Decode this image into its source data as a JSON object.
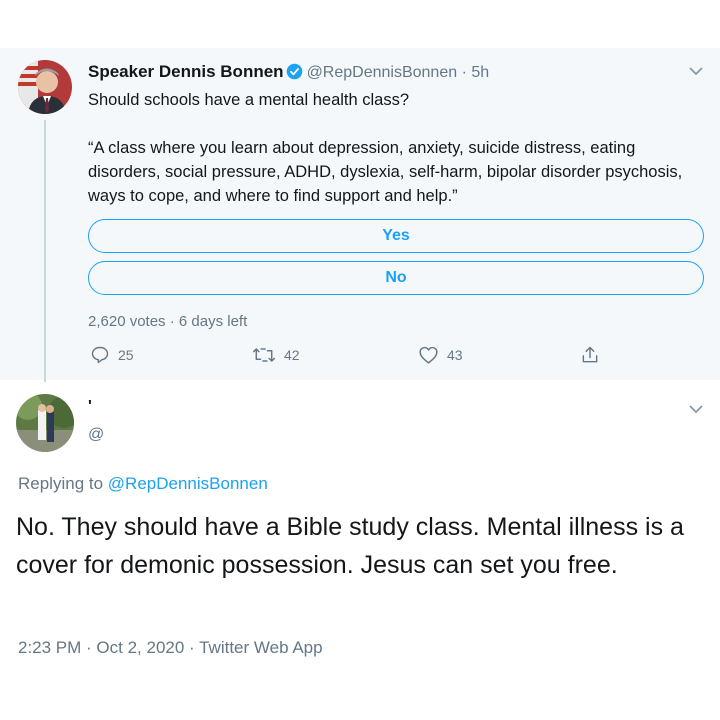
{
  "quoted_tweet": {
    "author_name": "Speaker Dennis Bonnen",
    "handle_time": "@RepDennisBonnen · 5h",
    "question": "Should schools have a mental health class?",
    "quote": "“A class where you learn about depression, anxiety, suicide distress, eating disorders, social pressure, ADHD, dyslexia, self-harm, bipolar disorder psychosis, ways to cope, and where to find support and help.”",
    "poll": {
      "options": [
        "Yes",
        "No"
      ],
      "meta": "2,620 votes · 6 days left"
    },
    "actions": {
      "replies": "25",
      "retweets": "42",
      "likes": "43"
    },
    "icons": [
      "verified-badge-icon",
      "chevron-down-icon",
      "reply-icon",
      "retweet-icon",
      "like-icon",
      "share-icon"
    ],
    "accent_color": "#1da1f2"
  },
  "reply_tweet": {
    "author_name": "'",
    "handle": "@",
    "replying_prefix": "Replying to",
    "replying_handle": "@RepDennisBonnen",
    "text": "No. They should have a Bible study class. Mental illness is a cover for demonic possession. Jesus can set you free.",
    "timestamp": "2:23 PM · Oct 2, 2020 · Twitter Web App"
  }
}
